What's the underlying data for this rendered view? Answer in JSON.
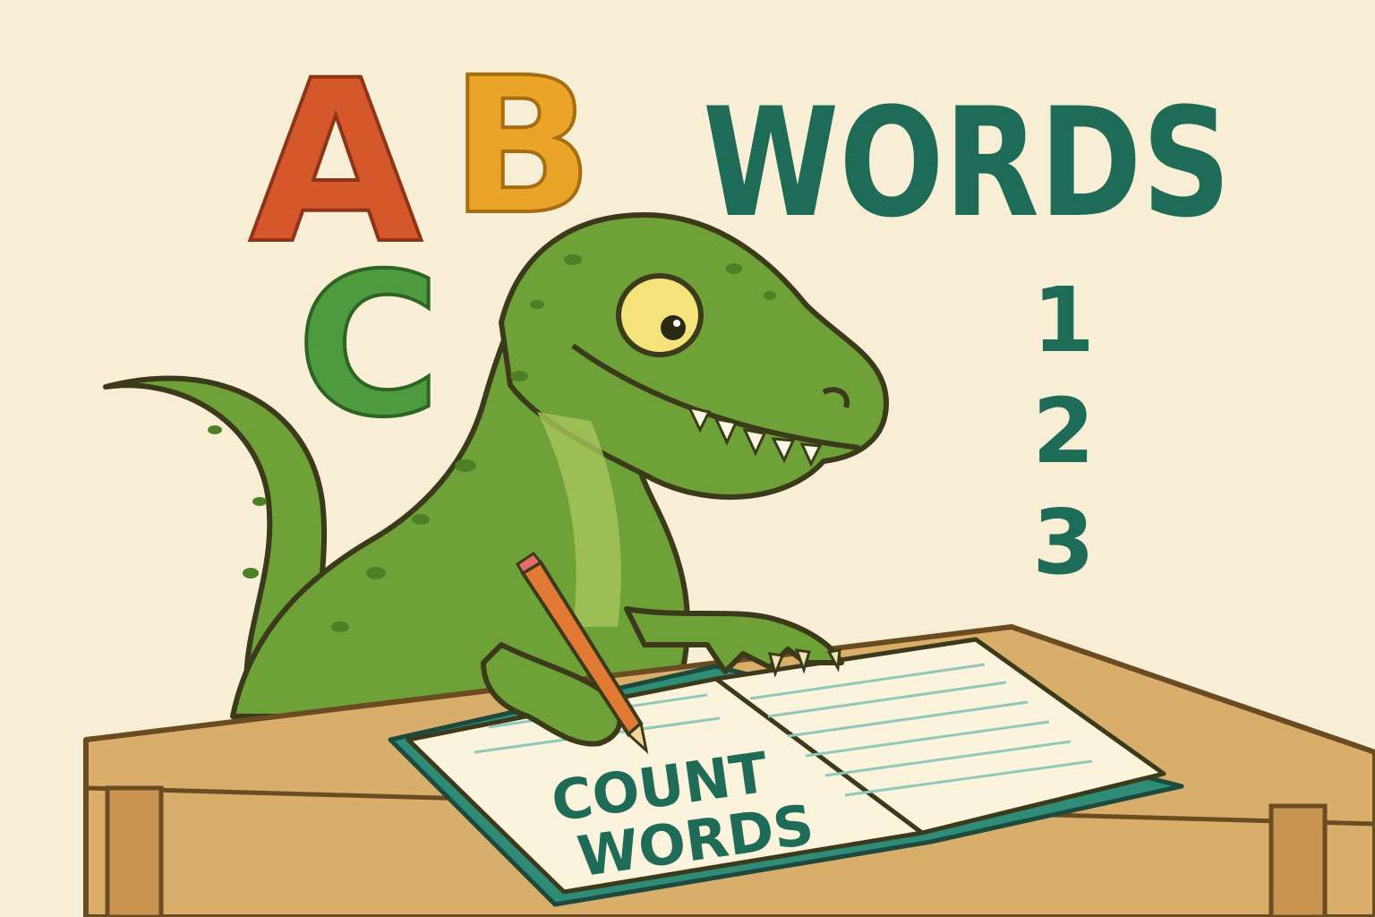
{
  "letters": {
    "a": "A",
    "b": "B",
    "c": "C"
  },
  "heading": "WORDS",
  "numbers": [
    "1",
    "2",
    "3"
  ],
  "book": {
    "line1": "COUNT",
    "line2": "WORDS"
  },
  "colors": {
    "background": "#f8eed5",
    "letter_a": "#d4582b",
    "letter_b": "#eaa528",
    "letter_c": "#4e9a3f",
    "teal": "#1e6b57",
    "dino": "#6ea238",
    "dino_spots": "#4d7f26",
    "desk": "#d9ad6a",
    "book_cover": "#2f8c76",
    "pencil": "#e07a34",
    "outline": "#3b3a1a"
  }
}
